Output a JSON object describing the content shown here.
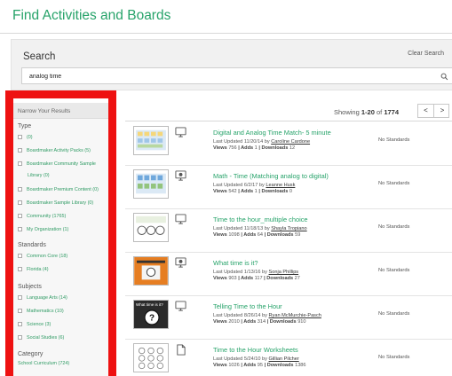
{
  "page": {
    "title": "Find Activities and Boards"
  },
  "search": {
    "label": "Search",
    "clear_label": "Clear Search",
    "value": "analog time"
  },
  "sidebar": {
    "heading": "Narrow Your Results",
    "groups": [
      {
        "name": "Type",
        "items": [
          "(0)",
          "Boardmaker Activity Packs (5)",
          "Boardmaker Community Sample",
          "Library (0)",
          "Boardmaker Premium Content (0)",
          "Boardmaker Sample Library (0)",
          "Community (1765)",
          "My Organization (1)"
        ]
      },
      {
        "name": "Standards",
        "items": [
          "Common Core (18)",
          "Florida (4)"
        ]
      },
      {
        "name": "Subjects",
        "items": [
          "Language Arts (14)",
          "Mathematics (10)",
          "Science (3)",
          "Social Studies (6)"
        ]
      },
      {
        "name": "Category",
        "items": [
          "School Curriculum (724)"
        ]
      }
    ]
  },
  "results": {
    "showing_prefix": "Showing ",
    "showing_range": "1-20",
    "showing_of": " of ",
    "showing_total": "1774",
    "prev_label": "<",
    "next_label": ">",
    "items": [
      {
        "title": "Digital and Analog Time Match- 5 minute",
        "updated": "Last Updated 11/20/14 by ",
        "author": "Caroline Cardone",
        "views": "756",
        "adds": "1",
        "downloads": "12",
        "standards": "No Standards",
        "type_icon": "monitor-icon"
      },
      {
        "title": "Math - Time (Matching analog to digital)",
        "updated": "Last Updated 6/2/17 by ",
        "author": "Leanne Husk",
        "views": "542",
        "adds": "1",
        "downloads": "0",
        "standards": "No Standards",
        "type_icon": "interactive-monitor-icon"
      },
      {
        "title": "Time to the hour_multiple choice",
        "updated": "Last Updated 11/18/13 by ",
        "author": "Shayla Tropiano",
        "views": "1098",
        "adds": "64",
        "downloads": "59",
        "standards": "No Standards",
        "type_icon": "monitor-icon"
      },
      {
        "title": "What time is it?",
        "updated": "Last Updated 1/13/16 by ",
        "author": "Sonja Phillips",
        "views": "903",
        "adds": "117",
        "downloads": "27",
        "standards": "No Standards",
        "type_icon": "interactive-monitor-icon"
      },
      {
        "title": "Telling Time to the Hour",
        "updated": "Last Updated 8/26/14 by ",
        "author": "Ryan McMurchie-Pasch",
        "views": "2010",
        "adds": "314",
        "downloads": "910",
        "standards": "No Standards",
        "type_icon": "monitor-icon"
      },
      {
        "title": "Time to the Hour Worksheets",
        "updated": "Last Updated 5/24/10 by ",
        "author": "Gillian Pilcher",
        "views": "1026",
        "adds": "95",
        "downloads": "1386",
        "standards": "No Standards",
        "type_icon": "document-icon"
      }
    ],
    "thumbnail_5_caption": "What time is it?",
    "meta_labels": {
      "views": "Views ",
      "adds": " | Adds ",
      "downloads": " | Downloads "
    }
  },
  "colors": {
    "accent_green": "#27a36a",
    "highlight_red": "#ee1111"
  }
}
